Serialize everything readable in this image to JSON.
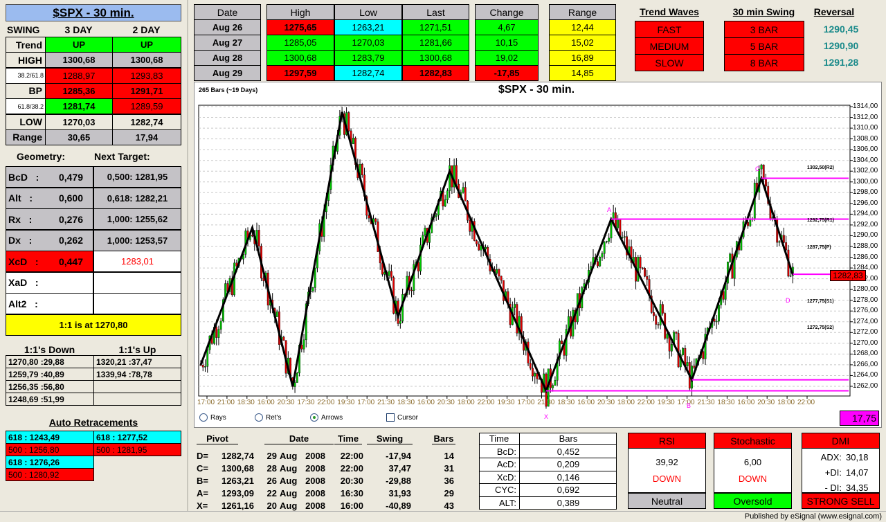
{
  "title": "$SPX - 30 min.",
  "swing": {
    "label": "SWING",
    "cols": [
      "3 DAY",
      "2 DAY"
    ],
    "rows": [
      {
        "label": "Trend",
        "v": [
          "UP",
          "UP"
        ],
        "c": [
          "grn",
          "grn"
        ],
        "lc": "beige"
      },
      {
        "label": "HIGH",
        "v": [
          "1300,68",
          "1300,68"
        ],
        "c": [
          "gry",
          "gry"
        ],
        "lc": "beige"
      },
      {
        "label": "38.2/61.8",
        "v": [
          "1288,97",
          "1293,83"
        ],
        "c": [
          "red",
          "red"
        ],
        "lc": "wht",
        "small": true
      },
      {
        "label": "BP",
        "v": [
          "1285,36",
          "1291,71"
        ],
        "c": [
          "red",
          "red"
        ],
        "lc": "beige"
      },
      {
        "label": "61.8/38.2",
        "v": [
          "1281,74",
          "1289,59"
        ],
        "c": [
          "grn",
          "red"
        ],
        "lc": "wht",
        "small": true
      },
      {
        "label": "LOW",
        "v": [
          "1270,03",
          "1282,74"
        ],
        "c": [
          "beige",
          "beige"
        ],
        "lc": "beige"
      },
      {
        "label": "Range",
        "v": [
          "30,65",
          "17,94"
        ],
        "c": [
          "gry",
          "gry"
        ],
        "lc": "gry"
      }
    ]
  },
  "geometry": {
    "header": "Geometry:",
    "target_header": "Next Target:",
    "rows": [
      {
        "label": "BcD",
        "value": "0,479",
        "target": "0,500: 1281,95",
        "c": "gry",
        "tc": "gry"
      },
      {
        "label": "Alt",
        "value": "0,600",
        "target": "0,618: 1282,21",
        "c": "gry",
        "tc": "gry"
      },
      {
        "label": "Rx",
        "value": "0,276",
        "target": "1,000: 1255,62",
        "c": "gry",
        "tc": "gry"
      },
      {
        "label": "Dx",
        "value": "0,262",
        "target": "1,000: 1253,57",
        "c": "gry",
        "tc": "gry"
      },
      {
        "label": "XcD",
        "value": "0,447",
        "target": "1283,01",
        "c": "red",
        "tc": "wht",
        "red_target": true
      },
      {
        "label": "XaD",
        "value": "",
        "target": "",
        "c": "wht",
        "tc": "wht"
      },
      {
        "label": "Alt2",
        "value": "",
        "target": "",
        "c": "wht",
        "tc": "wht"
      }
    ],
    "one_to_one": "1:1 is at 1270,80"
  },
  "ones": {
    "down_header": "1:1's Down",
    "up_header": "1:1's Up",
    "down": [
      "1270,80 :29,88",
      "1259,79 :40,89",
      "1256,35 :56,80",
      "1248,69 :51,99"
    ],
    "up": [
      "1320,21 :37,47",
      "1339,94 :78,78",
      "",
      ""
    ]
  },
  "retracements": {
    "header": "Auto Retracements",
    "left": [
      {
        "t": "618 : 1243,49",
        "c": "cyn"
      },
      {
        "t": "500 : 1256,80",
        "c": "red"
      },
      {
        "t": "618 : 1276,26",
        "c": "cyn"
      },
      {
        "t": "500 : 1280,92",
        "c": "red"
      }
    ],
    "right": [
      {
        "t": "618 : 1277,52",
        "c": "cyn"
      },
      {
        "t": "500 : 1281,95",
        "c": "red"
      }
    ]
  },
  "daily": {
    "headers": [
      "Date",
      "High",
      "Low",
      "Last",
      "Change",
      "Range"
    ],
    "rows": [
      {
        "date": "Aug 26",
        "high": "1275,65",
        "low": "1263,21",
        "last": "1271,51",
        "change": "4,67",
        "range": "12,44",
        "c": [
          "red",
          "cyn",
          "grn",
          "grn",
          "yel"
        ]
      },
      {
        "date": "Aug 27",
        "high": "1285,05",
        "low": "1270,03",
        "last": "1281,66",
        "change": "10,15",
        "range": "15,02",
        "c": [
          "grn",
          "grn",
          "grn",
          "grn",
          "yel"
        ]
      },
      {
        "date": "Aug 28",
        "high": "1300,68",
        "low": "1283,79",
        "last": "1300,68",
        "change": "19,02",
        "range": "16,89",
        "c": [
          "grn",
          "grn",
          "grn",
          "grn",
          "yel"
        ]
      },
      {
        "date": "Aug 29",
        "high": "1297,59",
        "low": "1282,74",
        "last": "1282,83",
        "change": "-17,85",
        "range": "14,85",
        "c": [
          "red",
          "cyn",
          "red",
          "red",
          "yel"
        ]
      }
    ]
  },
  "trend": {
    "waves_header": "Trend Waves",
    "swing_header": "30 min Swing",
    "reversal_header": "Reversal",
    "waves": [
      "FAST",
      "MEDIUM",
      "SLOW"
    ],
    "swings": [
      "3 BAR",
      "5 BAR",
      "8 BAR"
    ],
    "reversals": [
      "1290,45",
      "1290,90",
      "1291,28"
    ],
    "reversal_color": "#1a8a8a"
  },
  "chart": {
    "bars_label": "265 Bars (~19 Days)",
    "title": "$SPX - 30 min.",
    "last_price": "1282,83",
    "range_value": "17,75",
    "pivot_labels": {
      "R2": "1302,50(R2)",
      "R1": "1292,75(R1)",
      "P": "1287,75(P)",
      "S1": "1277,75(S1)",
      "S2": "1272,75(S2)"
    },
    "points": {
      "X": "X",
      "A": "A",
      "B": "B",
      "C": "C",
      "D": "D"
    },
    "options": [
      {
        "label": "Rays",
        "type": "radio",
        "on": false
      },
      {
        "label": "Ret's",
        "type": "radio",
        "on": false
      },
      {
        "label": "Arrows",
        "type": "radio",
        "on": true
      },
      {
        "label": "Cursor",
        "type": "checkbox",
        "on": false
      }
    ]
  },
  "chart_data": {
    "type": "candlestick",
    "ylim": [
      1260,
      1314
    ],
    "y_ticks": [
      "1314,00",
      "1312,00",
      "1310,00",
      "1308,00",
      "1306,00",
      "1304,00",
      "1302,00",
      "1300,00",
      "1298,00",
      "1296,00",
      "1294,00",
      "1292,00",
      "1290,00",
      "1288,00",
      "1286,00",
      "1284,00",
      "1282,00",
      "1280,00",
      "1278,00",
      "1276,00",
      "1274,00",
      "1272,00",
      "1270,00",
      "1268,00",
      "1266,00",
      "1264,00",
      "1262,00"
    ],
    "x_ticks": [
      "17:00",
      "21:00",
      "18:30",
      "16:00",
      "20:30",
      "17:30",
      "22:00",
      "19:30",
      "17:00",
      "21:30",
      "18:30",
      "16:00",
      "20:30",
      "18:00",
      "22:00",
      "19:30",
      "17:00",
      "21:30",
      "18:30",
      "16:00",
      "20:30",
      "18:00",
      "22:00",
      "19:30",
      "17:00",
      "21:30",
      "18:30",
      "16:00",
      "20:30",
      "18:00",
      "22:00"
    ],
    "bars": 265,
    "zigzag": [
      {
        "bar": 0,
        "price": 1266
      },
      {
        "bar": 23,
        "price": 1291.5
      },
      {
        "bar": 41,
        "price": 1262
      },
      {
        "bar": 63,
        "price": 1313
      },
      {
        "bar": 88,
        "price": 1275
      },
      {
        "bar": 111,
        "price": 1302
      },
      {
        "bar": 154,
        "price": 1261.16
      },
      {
        "bar": 183,
        "price": 1293.09
      },
      {
        "bar": 219,
        "price": 1263.21
      },
      {
        "bar": 250,
        "price": 1300.68
      },
      {
        "bar": 264,
        "price": 1282.74
      }
    ],
    "levels": [
      {
        "price": 1300.68,
        "from_bar": 250
      },
      {
        "price": 1293.09,
        "from_bar": 183
      },
      {
        "price": 1282.83,
        "from_bar": 264
      },
      {
        "price": 1263.21,
        "from_bar": 219
      },
      {
        "price": 1261.16,
        "from_bar": 154
      }
    ],
    "level_color": "#ff00ff"
  },
  "pivots": {
    "headers": [
      "Pivot",
      "Date",
      "Time",
      "Swing",
      "Bars"
    ],
    "rows": [
      {
        "n": "D=",
        "p": "1282,74",
        "d": "29",
        "m": "Aug",
        "y": "2008",
        "t": "22:00",
        "s": "-17,94",
        "b": "14"
      },
      {
        "n": "C=",
        "p": "1300,68",
        "d": "28",
        "m": "Aug",
        "y": "2008",
        "t": "22:00",
        "s": "37,47",
        "b": "31"
      },
      {
        "n": "B=",
        "p": "1263,21",
        "d": "26",
        "m": "Aug",
        "y": "2008",
        "t": "20:30",
        "s": "-29,88",
        "b": "36"
      },
      {
        "n": "A=",
        "p": "1293,09",
        "d": "22",
        "m": "Aug",
        "y": "2008",
        "t": "16:30",
        "s": "31,93",
        "b": "29"
      },
      {
        "n": "X=",
        "p": "1261,16",
        "d": "20",
        "m": "Aug",
        "y": "2008",
        "t": "16:00",
        "s": "-40,89",
        "b": "43"
      }
    ]
  },
  "timebars": {
    "h1": "Time",
    "h2": "Bars",
    "rows": [
      {
        "k": "BcD:",
        "v": "0,452"
      },
      {
        "k": "AcD:",
        "v": "0,209"
      },
      {
        "k": "XcD:",
        "v": "0,146"
      },
      {
        "k": "CYC:",
        "v": "0,692"
      },
      {
        "k": "ALT:",
        "v": "0,389"
      }
    ]
  },
  "indicators": {
    "rsi": {
      "title": "RSI",
      "value": "39,92",
      "dir": "DOWN",
      "status": "Neutral"
    },
    "stoch": {
      "title": "Stochastic",
      "value": "6,00",
      "dir": "DOWN",
      "status": "Oversold"
    },
    "dmi": {
      "title": "DMI",
      "adx_l": "ADX:",
      "adx": "30,18",
      "pdi_l": "+DI:",
      "pdi": "14,07",
      "mdi_l": "- DI:",
      "mdi": "34,35",
      "status": "STRONG SELL"
    }
  },
  "footer": "Published by eSignal (www.esignal.com)"
}
